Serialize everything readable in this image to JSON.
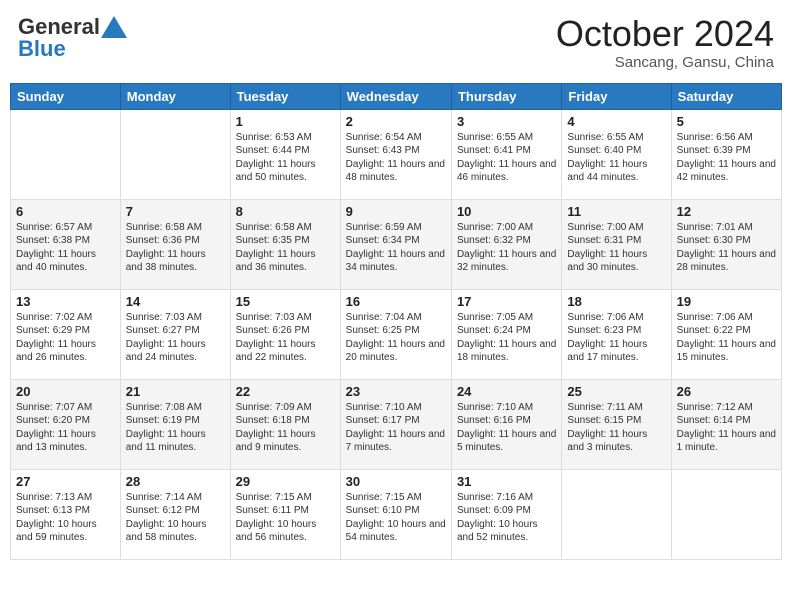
{
  "header": {
    "logo_general": "General",
    "logo_blue": "Blue",
    "month_title": "October 2024",
    "location": "Sancang, Gansu, China"
  },
  "weekdays": [
    "Sunday",
    "Monday",
    "Tuesday",
    "Wednesday",
    "Thursday",
    "Friday",
    "Saturday"
  ],
  "weeks": [
    {
      "alt": false,
      "days": [
        {
          "num": "",
          "sunrise": "",
          "sunset": "",
          "daylight": ""
        },
        {
          "num": "",
          "sunrise": "",
          "sunset": "",
          "daylight": ""
        },
        {
          "num": "1",
          "sunrise": "Sunrise: 6:53 AM",
          "sunset": "Sunset: 6:44 PM",
          "daylight": "Daylight: 11 hours and 50 minutes."
        },
        {
          "num": "2",
          "sunrise": "Sunrise: 6:54 AM",
          "sunset": "Sunset: 6:43 PM",
          "daylight": "Daylight: 11 hours and 48 minutes."
        },
        {
          "num": "3",
          "sunrise": "Sunrise: 6:55 AM",
          "sunset": "Sunset: 6:41 PM",
          "daylight": "Daylight: 11 hours and 46 minutes."
        },
        {
          "num": "4",
          "sunrise": "Sunrise: 6:55 AM",
          "sunset": "Sunset: 6:40 PM",
          "daylight": "Daylight: 11 hours and 44 minutes."
        },
        {
          "num": "5",
          "sunrise": "Sunrise: 6:56 AM",
          "sunset": "Sunset: 6:39 PM",
          "daylight": "Daylight: 11 hours and 42 minutes."
        }
      ]
    },
    {
      "alt": true,
      "days": [
        {
          "num": "6",
          "sunrise": "Sunrise: 6:57 AM",
          "sunset": "Sunset: 6:38 PM",
          "daylight": "Daylight: 11 hours and 40 minutes."
        },
        {
          "num": "7",
          "sunrise": "Sunrise: 6:58 AM",
          "sunset": "Sunset: 6:36 PM",
          "daylight": "Daylight: 11 hours and 38 minutes."
        },
        {
          "num": "8",
          "sunrise": "Sunrise: 6:58 AM",
          "sunset": "Sunset: 6:35 PM",
          "daylight": "Daylight: 11 hours and 36 minutes."
        },
        {
          "num": "9",
          "sunrise": "Sunrise: 6:59 AM",
          "sunset": "Sunset: 6:34 PM",
          "daylight": "Daylight: 11 hours and 34 minutes."
        },
        {
          "num": "10",
          "sunrise": "Sunrise: 7:00 AM",
          "sunset": "Sunset: 6:32 PM",
          "daylight": "Daylight: 11 hours and 32 minutes."
        },
        {
          "num": "11",
          "sunrise": "Sunrise: 7:00 AM",
          "sunset": "Sunset: 6:31 PM",
          "daylight": "Daylight: 11 hours and 30 minutes."
        },
        {
          "num": "12",
          "sunrise": "Sunrise: 7:01 AM",
          "sunset": "Sunset: 6:30 PM",
          "daylight": "Daylight: 11 hours and 28 minutes."
        }
      ]
    },
    {
      "alt": false,
      "days": [
        {
          "num": "13",
          "sunrise": "Sunrise: 7:02 AM",
          "sunset": "Sunset: 6:29 PM",
          "daylight": "Daylight: 11 hours and 26 minutes."
        },
        {
          "num": "14",
          "sunrise": "Sunrise: 7:03 AM",
          "sunset": "Sunset: 6:27 PM",
          "daylight": "Daylight: 11 hours and 24 minutes."
        },
        {
          "num": "15",
          "sunrise": "Sunrise: 7:03 AM",
          "sunset": "Sunset: 6:26 PM",
          "daylight": "Daylight: 11 hours and 22 minutes."
        },
        {
          "num": "16",
          "sunrise": "Sunrise: 7:04 AM",
          "sunset": "Sunset: 6:25 PM",
          "daylight": "Daylight: 11 hours and 20 minutes."
        },
        {
          "num": "17",
          "sunrise": "Sunrise: 7:05 AM",
          "sunset": "Sunset: 6:24 PM",
          "daylight": "Daylight: 11 hours and 18 minutes."
        },
        {
          "num": "18",
          "sunrise": "Sunrise: 7:06 AM",
          "sunset": "Sunset: 6:23 PM",
          "daylight": "Daylight: 11 hours and 17 minutes."
        },
        {
          "num": "19",
          "sunrise": "Sunrise: 7:06 AM",
          "sunset": "Sunset: 6:22 PM",
          "daylight": "Daylight: 11 hours and 15 minutes."
        }
      ]
    },
    {
      "alt": true,
      "days": [
        {
          "num": "20",
          "sunrise": "Sunrise: 7:07 AM",
          "sunset": "Sunset: 6:20 PM",
          "daylight": "Daylight: 11 hours and 13 minutes."
        },
        {
          "num": "21",
          "sunrise": "Sunrise: 7:08 AM",
          "sunset": "Sunset: 6:19 PM",
          "daylight": "Daylight: 11 hours and 11 minutes."
        },
        {
          "num": "22",
          "sunrise": "Sunrise: 7:09 AM",
          "sunset": "Sunset: 6:18 PM",
          "daylight": "Daylight: 11 hours and 9 minutes."
        },
        {
          "num": "23",
          "sunrise": "Sunrise: 7:10 AM",
          "sunset": "Sunset: 6:17 PM",
          "daylight": "Daylight: 11 hours and 7 minutes."
        },
        {
          "num": "24",
          "sunrise": "Sunrise: 7:10 AM",
          "sunset": "Sunset: 6:16 PM",
          "daylight": "Daylight: 11 hours and 5 minutes."
        },
        {
          "num": "25",
          "sunrise": "Sunrise: 7:11 AM",
          "sunset": "Sunset: 6:15 PM",
          "daylight": "Daylight: 11 hours and 3 minutes."
        },
        {
          "num": "26",
          "sunrise": "Sunrise: 7:12 AM",
          "sunset": "Sunset: 6:14 PM",
          "daylight": "Daylight: 11 hours and 1 minute."
        }
      ]
    },
    {
      "alt": false,
      "days": [
        {
          "num": "27",
          "sunrise": "Sunrise: 7:13 AM",
          "sunset": "Sunset: 6:13 PM",
          "daylight": "Daylight: 10 hours and 59 minutes."
        },
        {
          "num": "28",
          "sunrise": "Sunrise: 7:14 AM",
          "sunset": "Sunset: 6:12 PM",
          "daylight": "Daylight: 10 hours and 58 minutes."
        },
        {
          "num": "29",
          "sunrise": "Sunrise: 7:15 AM",
          "sunset": "Sunset: 6:11 PM",
          "daylight": "Daylight: 10 hours and 56 minutes."
        },
        {
          "num": "30",
          "sunrise": "Sunrise: 7:15 AM",
          "sunset": "Sunset: 6:10 PM",
          "daylight": "Daylight: 10 hours and 54 minutes."
        },
        {
          "num": "31",
          "sunrise": "Sunrise: 7:16 AM",
          "sunset": "Sunset: 6:09 PM",
          "daylight": "Daylight: 10 hours and 52 minutes."
        },
        {
          "num": "",
          "sunrise": "",
          "sunset": "",
          "daylight": ""
        },
        {
          "num": "",
          "sunrise": "",
          "sunset": "",
          "daylight": ""
        }
      ]
    }
  ]
}
